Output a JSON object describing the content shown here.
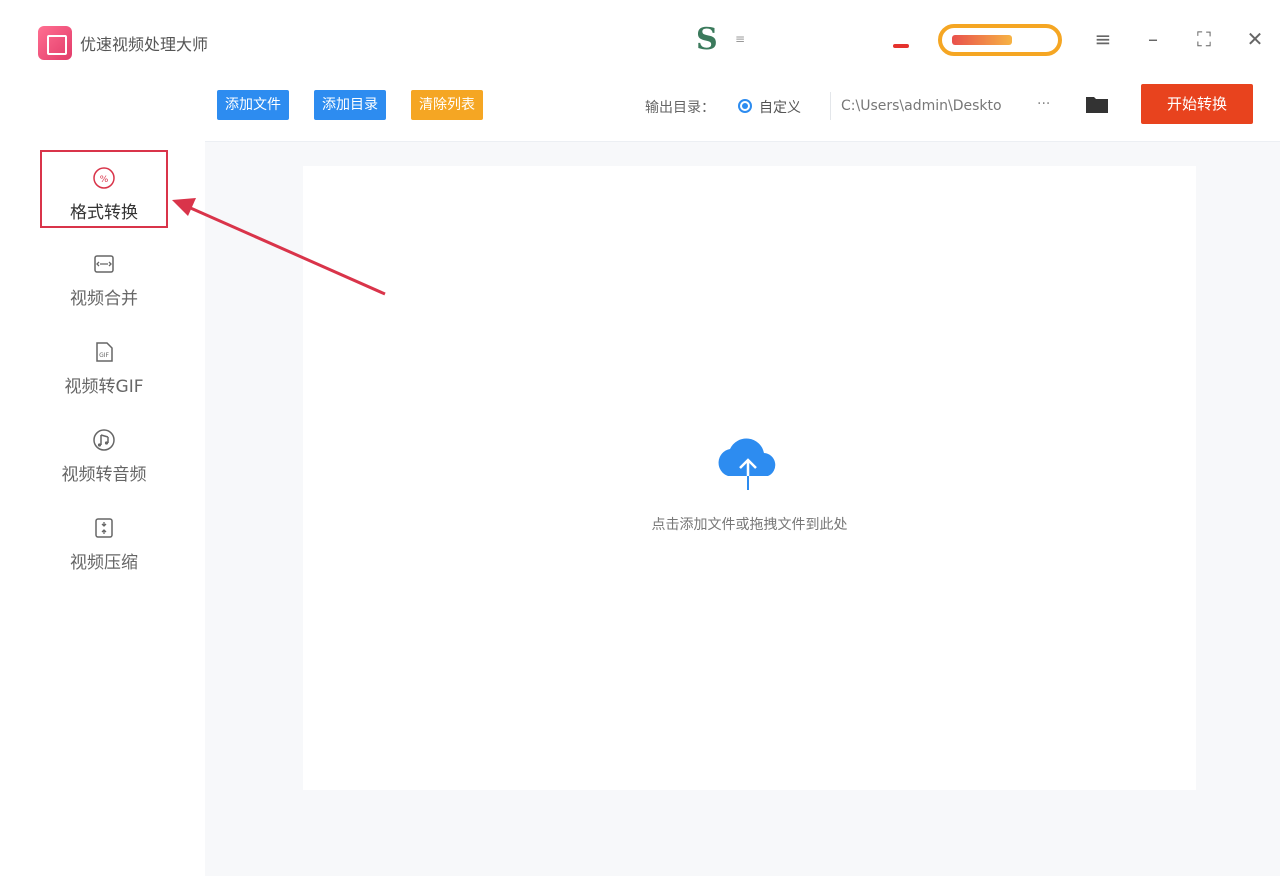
{
  "app": {
    "title": "优速视频处理大师"
  },
  "brand": {
    "logo_text": "S",
    "sub_text": "≡"
  },
  "window_controls": {
    "menu": "≡",
    "minimize": "–",
    "maximize": "⛶",
    "close": "✕"
  },
  "sidebar": {
    "items": [
      {
        "label": "格式转换",
        "icon": "format-convert-icon",
        "active": true
      },
      {
        "label": "视频合并",
        "icon": "video-merge-icon",
        "active": false
      },
      {
        "label": "视频转GIF",
        "icon": "video-gif-icon",
        "active": false
      },
      {
        "label": "视频转音频",
        "icon": "video-audio-icon",
        "active": false
      },
      {
        "label": "视频压缩",
        "icon": "video-compress-icon",
        "active": false
      }
    ]
  },
  "toolbar": {
    "add_file": "添加文件",
    "add_dir": "添加目录",
    "clear_list": "清除列表",
    "output_label": "输出目录：",
    "radio_label": "自定义",
    "path": "C:\\Users\\admin\\Deskto",
    "more": "···",
    "start": "开始转换"
  },
  "main": {
    "drop_hint": "点击添加文件或拖拽文件到此处"
  },
  "colors": {
    "blue_button": "#2d8cf0",
    "orange_button": "#f5a623",
    "start_button": "#e8431e",
    "highlight": "#d9344a",
    "cloud": "#2d8cf0"
  }
}
